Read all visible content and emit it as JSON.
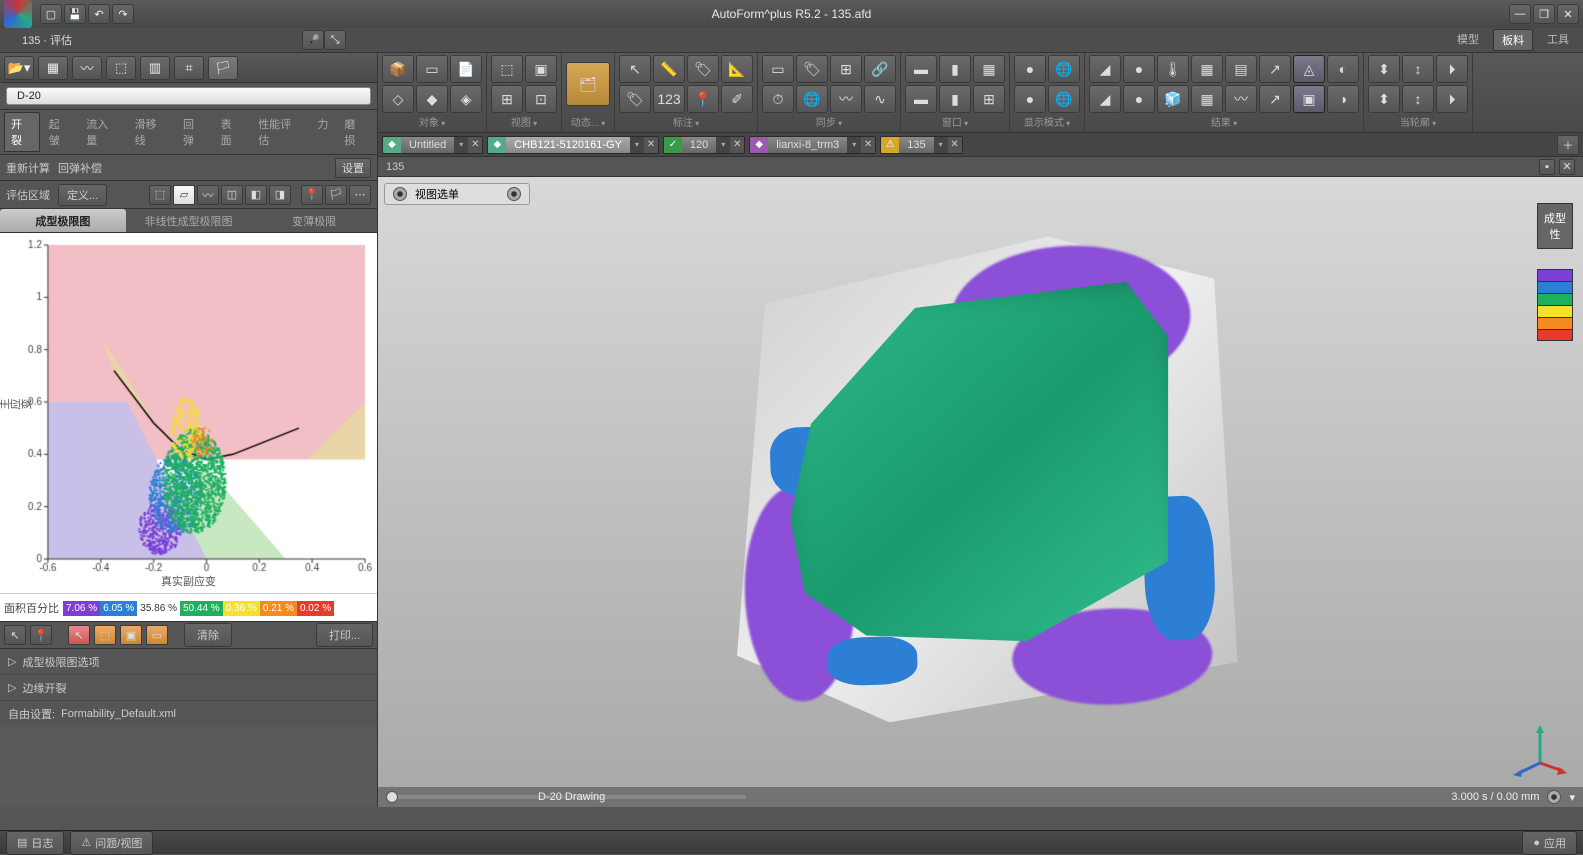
{
  "app": {
    "title": "AutoForm^plus R5.2 - 135.afd"
  },
  "qat": [
    "new",
    "save",
    "undo",
    "redo"
  ],
  "secondary": {
    "title": "135 · 评估",
    "micIcon": "mic",
    "arrowIcon": "arrow",
    "menu": [
      "模型",
      "板料",
      "工具"
    ],
    "activeMenu": 1
  },
  "left": {
    "toolbarIcons": [
      "open",
      "grid",
      "curve",
      "grid2",
      "panel",
      "code",
      "route"
    ],
    "pill": "D-20",
    "tabs": [
      "开裂",
      "起皱",
      "流入量",
      "滑移线",
      "回弹",
      "表面",
      "性能评估",
      "力",
      "磨损"
    ],
    "activeTab": 0,
    "row2": {
      "left": "重新计算",
      "right": "回弹补偿",
      "btn": "设置"
    },
    "row3": {
      "left": "评估区域",
      "right": "定义..."
    },
    "chartTabs": [
      "成型极限图",
      "非线性成型极限图",
      "变薄极限"
    ],
    "activeChartTab": 0,
    "percentRow": {
      "label": "面积百分比",
      "cells": [
        {
          "val": "7.06 %",
          "bg": "#7b3fd6"
        },
        {
          "val": "6.05 %",
          "bg": "#2d7fd6"
        },
        {
          "val": "35.86 %",
          "bg": "#ffffff",
          "txt": true
        },
        {
          "val": "50.44 %",
          "bg": "#1eb05f"
        },
        {
          "val": "0.36 %",
          "bg": "#f5e02a"
        },
        {
          "val": "0.21 %",
          "bg": "#f58a1e"
        },
        {
          "val": "0.02 %",
          "bg": "#e63a2a"
        }
      ]
    },
    "tb2": {
      "buttons": [
        "清除",
        "打印..."
      ]
    },
    "expanders": [
      "成型极限图选项",
      "边缘开裂"
    ],
    "freeSetting": {
      "label": "自由设置:",
      "val": "Formability_Default.xml"
    }
  },
  "ribbon": {
    "groups": [
      {
        "label": "对象",
        "cols": 3
      },
      {
        "label": "视图",
        "cols": 2
      },
      {
        "label": "动态...",
        "cols": 1,
        "large": true
      },
      {
        "label": "标注",
        "cols": 4
      },
      {
        "label": "同步",
        "cols": 4
      },
      {
        "label": "窗口",
        "cols": 3
      },
      {
        "label": "显示模式",
        "cols": 2
      },
      {
        "label": "结果",
        "cols": 8
      },
      {
        "label": "当轮廓",
        "cols": 3
      }
    ]
  },
  "docTabs": [
    {
      "icon": "◆",
      "iconBg": "#5a8",
      "label": "Untitled",
      "dd": true
    },
    {
      "icon": "◆",
      "iconBg": "#5a8",
      "label": "CHB121-5120161-GY",
      "dd": true,
      "active": true
    },
    {
      "icon": "✓",
      "iconBg": "#3a9a4a",
      "label": "120",
      "dd": true
    },
    {
      "icon": "◆",
      "iconBg": "#9a5ab0",
      "label": "lianxi-8_trm3",
      "dd": true
    },
    {
      "icon": "⚠",
      "iconBg": "#d6a82a",
      "label": "135",
      "dd": true
    }
  ],
  "crumb": "135",
  "viewport": {
    "menuLabel": "视图选单",
    "legendTitle": "成型性",
    "legendColors": [
      "#7b3fd6",
      "#2d7fd6",
      "#1eb05f",
      "#f5e02a",
      "#f58a1e",
      "#e63a2a"
    ],
    "status": {
      "center": "D-20 Drawing",
      "right": "3.000 s / 0.00 mm"
    }
  },
  "footbar": {
    "btn1": "日志",
    "btn2": "问题/视图",
    "btn3": "应用"
  },
  "chart_data": {
    "type": "scatter",
    "title": "成型极限图",
    "xlabel": "真实副应变",
    "ylabel": "真实主应变",
    "xlim": [
      -0.6,
      0.6
    ],
    "ylim": [
      0,
      1.2
    ],
    "xticks": [
      -0.6,
      -0.4,
      -0.2,
      0,
      0.2,
      0.4,
      0.6
    ],
    "yticks": [
      0,
      0.2,
      0.4,
      0.6,
      0.8,
      1,
      1.2
    ],
    "flc_curve": [
      [
        -0.35,
        0.72
      ],
      [
        -0.2,
        0.52
      ],
      [
        -0.1,
        0.42
      ],
      [
        0,
        0.38
      ],
      [
        0.1,
        0.4
      ],
      [
        0.2,
        0.44
      ],
      [
        0.35,
        0.5
      ]
    ],
    "regions": [
      {
        "name": "crack",
        "color": "#f3bfc6"
      },
      {
        "name": "risk",
        "color": "#e8d6a8"
      },
      {
        "name": "safe",
        "color": "#c8e8c2"
      },
      {
        "name": "compress",
        "color": "#c8c0e8"
      },
      {
        "name": "wrinkle_tend",
        "color": "#a8c8e8"
      },
      {
        "name": "wrinkle",
        "color": "#d0d0d0"
      }
    ],
    "point_cloud_summary": "dense scatter concentrated x∈[-0.25,0.1], y∈[0.05,0.7], mostly green/blue with purple at bottom-left and yellow/orange near FLC",
    "series": [
      {
        "name": "purple",
        "color": "#7b3fd6",
        "area_pct": 7.06
      },
      {
        "name": "blue",
        "color": "#2d7fd6",
        "area_pct": 6.05
      },
      {
        "name": "gray",
        "color": "#cccccc",
        "area_pct": 35.86
      },
      {
        "name": "green",
        "color": "#1eb05f",
        "area_pct": 50.44
      },
      {
        "name": "yellow",
        "color": "#f5e02a",
        "area_pct": 0.36
      },
      {
        "name": "orange",
        "color": "#f58a1e",
        "area_pct": 0.21
      },
      {
        "name": "red",
        "color": "#e63a2a",
        "area_pct": 0.02
      }
    ]
  }
}
